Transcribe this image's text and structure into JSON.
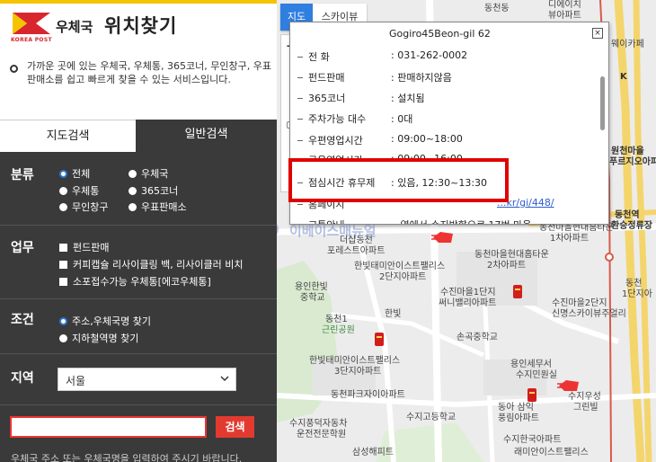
{
  "header": {
    "logo_en": "KOREA POST",
    "title_prefix": "우체국",
    "title_main": "위치찾기",
    "description": "가까운 곳에 있는 우체국, 우체통, 365코너, 무인창구, 우표판매소를 쉽고 빠르게 찾을 수 있는 서비스입니다."
  },
  "tabs": {
    "map_search": "지도검색",
    "normal_search": "일반검색"
  },
  "filters": {
    "category": {
      "title": "분류",
      "options": [
        "전체",
        "우체국",
        "우체통",
        "365코너",
        "무인창구",
        "우표판매소"
      ],
      "selected": "전체"
    },
    "business": {
      "title": "업무",
      "options": [
        "펀드판매",
        "커피캡슐 리사이클링 백, 리사이클러 비치",
        "소포접수가능 우체통[에코우체통]"
      ]
    },
    "condition": {
      "title": "조건",
      "options": [
        "주소,우체국명 찾기",
        "지하철역명 찾기"
      ],
      "selected": "주소,우체국명 찾기"
    },
    "region": {
      "title": "지역",
      "value": "서울"
    }
  },
  "search": {
    "button_label": "검색",
    "input_value": "",
    "hint": "우체국 주소 또는 우체국명을 입력하여 주시기 바랍니다."
  },
  "map_controls": {
    "map_label": "지도",
    "sky_label": "스카이뷰",
    "zoom_plus": "+"
  },
  "info_window": {
    "address": "Gogiro45Beon-gil 62",
    "close": "×",
    "rows": [
      {
        "key": "전 화",
        "value": ": 031-262-0002"
      },
      {
        "key": "펀드판매",
        "value": ": 판매하지않음"
      },
      {
        "key": "365코너",
        "value": ": 설치됨"
      },
      {
        "key": "주차가능 대수",
        "value": ": 0대"
      },
      {
        "key": "우편영업시간",
        "value": ": 09:00~18:00"
      },
      {
        "key": "금융영업시간",
        "value": ": 09:00~16:00"
      },
      {
        "key": "점심시간 휴무제",
        "value": ": 있음, 12:30~13:30"
      },
      {
        "key": "홈페이지",
        "value": "...kr/gi/448/"
      },
      {
        "key": "교통안내",
        "value": "...역에서 수지방향으로 17번 마을"
      }
    ]
  },
  "watermark": "이베이스매뉴얼",
  "map_labels": [
    "동천동",
    "디에이치",
    "뷰아파트",
    "웨이카페",
    "K",
    "원천마을",
    "푸르지오아파트",
    "동천마을현대홈타운",
    "1차아파트",
    "동천역",
    "환승정류장",
    "더샵동천",
    "포레스트아파트",
    "한빛태미안이스트팰리스",
    "2단지아파트",
    "동천마을현대홈타운",
    "2차아파트",
    "용인한빛",
    "중학교",
    "한빛",
    "수진마을1단지",
    "써니밸리아파트",
    "수진마을2단지",
    "신명스카이뷰주얼리",
    "동천1",
    "근린공원",
    "손곡중학교",
    "한빛태미안이스트팰리스",
    "3단지아파트",
    "용인세무서",
    "수지민원실",
    "동천파크자이아파트",
    "수지고등학교",
    "동아 삼익",
    "풍림아파트",
    "수지우성",
    "그린빌",
    "수지풍덕자동차",
    "운전전문학원",
    "수지한국아파트",
    "삼성해피트",
    "래미안이스트팰리스",
    "동천",
    "1단지아"
  ]
}
